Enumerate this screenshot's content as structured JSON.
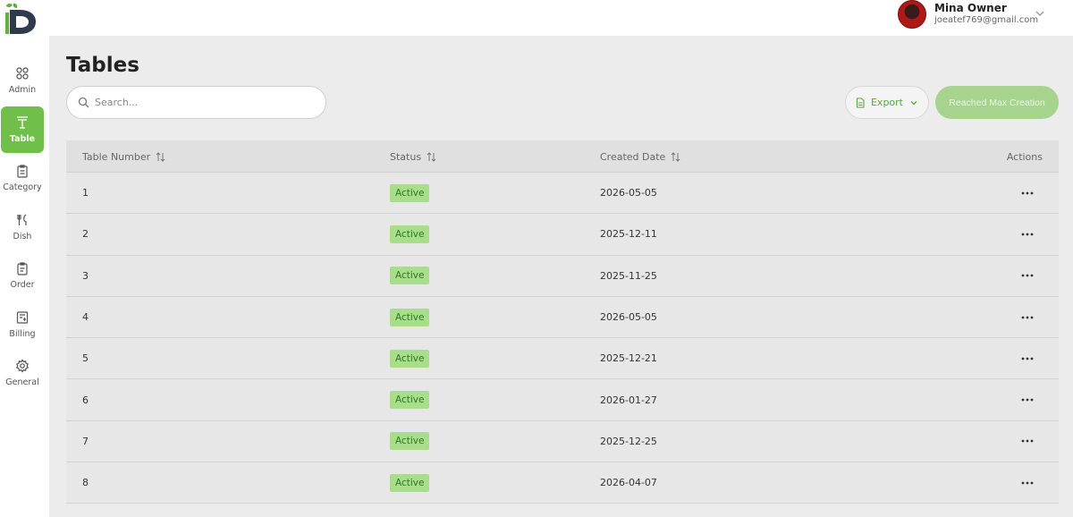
{
  "user": {
    "name": "Mina Owner",
    "email": "joeatef769@gmail.com"
  },
  "sidebar": {
    "items": [
      {
        "label": "Admin",
        "icon": "admin-icon",
        "active": false
      },
      {
        "label": "Table",
        "icon": "table-icon",
        "active": true
      },
      {
        "label": "Category",
        "icon": "category-icon",
        "active": false
      },
      {
        "label": "Dish",
        "icon": "dish-icon",
        "active": false
      },
      {
        "label": "Order",
        "icon": "order-icon",
        "active": false
      },
      {
        "label": "Billing",
        "icon": "billing-icon",
        "active": false
      },
      {
        "label": "General",
        "icon": "gear-icon",
        "active": false
      }
    ]
  },
  "page": {
    "title": "Tables"
  },
  "search": {
    "placeholder": "Search..."
  },
  "toolbar": {
    "export_label": "Export",
    "max_label": "Reached Max Creation"
  },
  "table": {
    "headers": {
      "number": "Table Number",
      "status": "Status",
      "created": "Created Date",
      "actions": "Actions"
    },
    "rows": [
      {
        "number": "1",
        "status": "Active",
        "created": "2026-05-05"
      },
      {
        "number": "2",
        "status": "Active",
        "created": "2025-12-11"
      },
      {
        "number": "3",
        "status": "Active",
        "created": "2025-11-25"
      },
      {
        "number": "4",
        "status": "Active",
        "created": "2026-05-05"
      },
      {
        "number": "5",
        "status": "Active",
        "created": "2025-12-21"
      },
      {
        "number": "6",
        "status": "Active",
        "created": "2026-01-27"
      },
      {
        "number": "7",
        "status": "Active",
        "created": "2025-12-25"
      },
      {
        "number": "8",
        "status": "Active",
        "created": "2026-04-07"
      }
    ]
  },
  "colors": {
    "accent": "#6fbf4a",
    "badge_bg": "#a7dd8b",
    "badge_text": "#2d7a1e",
    "disabled_btn": "#a6d48f"
  }
}
